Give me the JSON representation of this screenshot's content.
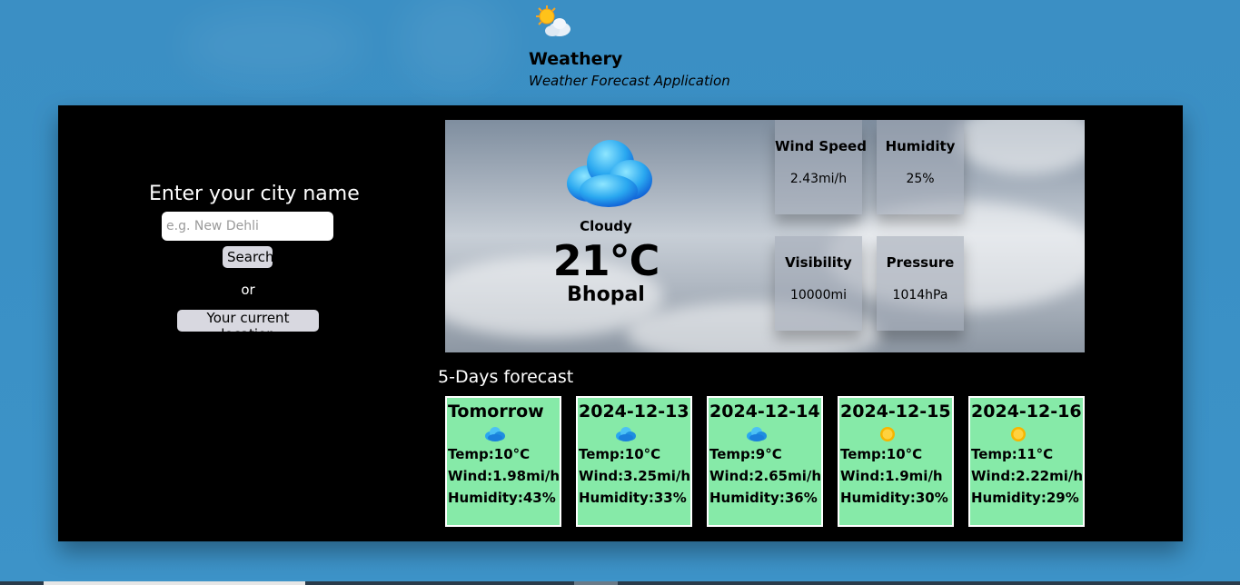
{
  "header": {
    "logo_icon": "sun-behind-cloud-icon",
    "title": "Weathery",
    "subtitle": "Weather Forecast Application"
  },
  "search": {
    "heading": "Enter your city name",
    "placeholder": "e.g. New Dehli",
    "search_button": "Search",
    "or_text": "or",
    "location_button": "Your current location"
  },
  "current": {
    "icon": "cloud-icon",
    "condition": "Cloudy",
    "temperature": "21°C",
    "city": "Bhopal",
    "stats": {
      "wind_label": "Wind Speed",
      "wind_value": "2.43mi/h",
      "humidity_label": "Humidity",
      "humidity_value": "25%",
      "visibility_label": "Visibility",
      "visibility_value": "10000mi",
      "pressure_label": "Pressure",
      "pressure_value": "1014hPa"
    }
  },
  "forecast": {
    "title": "5-Days forecast",
    "days": [
      {
        "date": "Tomorrow",
        "icon": "cloud-icon",
        "temp": "Temp:10°C",
        "wind": "Wind:1.98mi/h",
        "humidity": "Humidity:43%"
      },
      {
        "date": "2024-12-13",
        "icon": "cloud-icon",
        "temp": "Temp:10°C",
        "wind": "Wind:3.25mi/h",
        "humidity": "Humidity:33%"
      },
      {
        "date": "2024-12-14",
        "icon": "cloud-icon",
        "temp": "Temp:9°C",
        "wind": "Wind:2.65mi/h",
        "humidity": "Humidity:36%"
      },
      {
        "date": "2024-12-15",
        "icon": "sun-icon",
        "temp": "Temp:10°C",
        "wind": "Wind:1.9mi/h",
        "humidity": "Humidity:30%"
      },
      {
        "date": "2024-12-16",
        "icon": "sun-icon",
        "temp": "Temp:11°C",
        "wind": "Wind:2.22mi/h",
        "humidity": "Humidity:29%"
      }
    ]
  },
  "colors": {
    "page_background": "#3a90c5",
    "panel_background": "#000000",
    "forecast_card": "#86eaa8",
    "button": "#d8d8e0"
  }
}
